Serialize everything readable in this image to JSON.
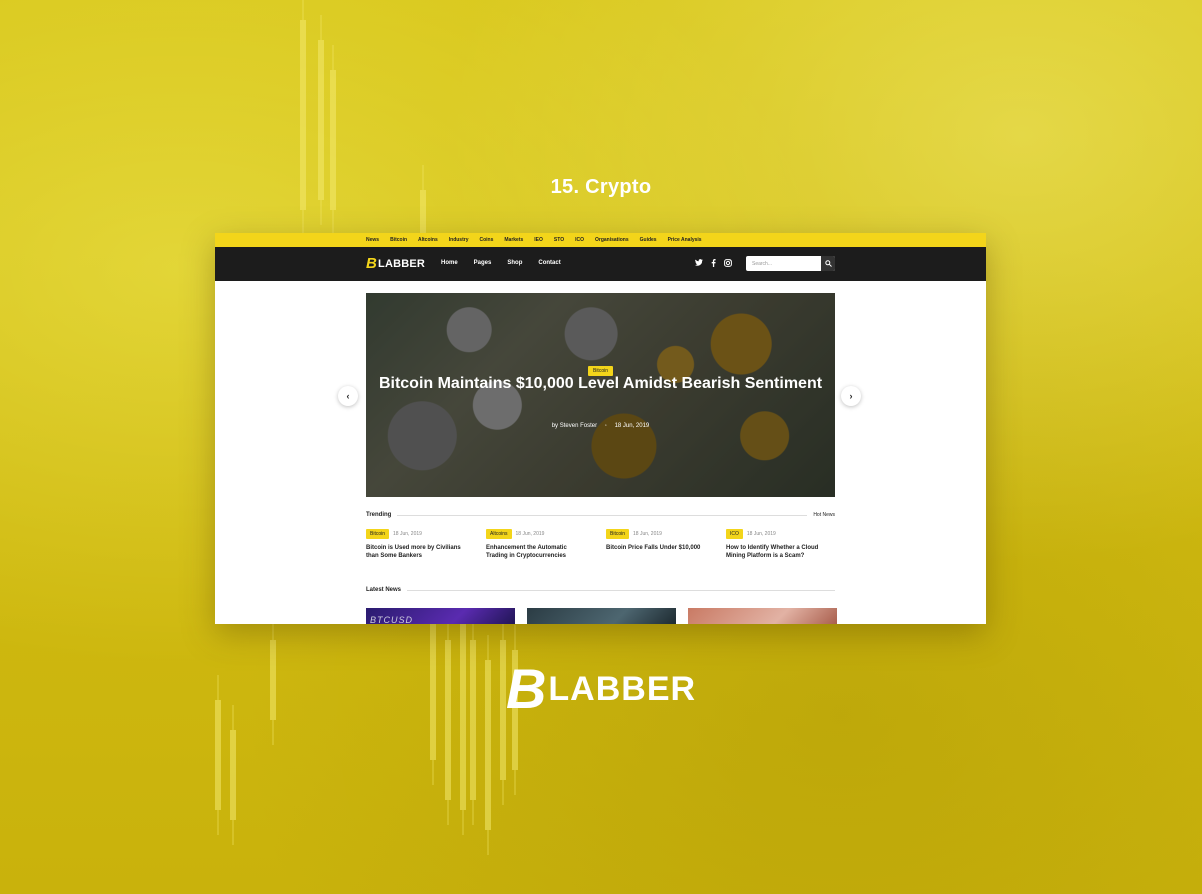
{
  "colors": {
    "accent": "#f3d51a",
    "nav_bg": "#1c1c1c",
    "background": "#d6c216"
  },
  "preview_title": "15. Crypto",
  "topbar": {
    "items": [
      "News",
      "Bitcoin",
      "Altcoins",
      "Industry",
      "Coins",
      "Markets",
      "IEO",
      "STO",
      "ICO",
      "Organisations",
      "Guides",
      "Price Analysis"
    ]
  },
  "navbar": {
    "logo_mark": "B",
    "logo_text": "LABBER",
    "links": [
      "Home",
      "Pages",
      "Shop",
      "Contact"
    ],
    "social_icons": [
      "twitter-icon",
      "facebook-icon",
      "instagram-icon"
    ],
    "search_placeholder": "Search...",
    "search_icon": "search-icon"
  },
  "hero": {
    "tag": "Bitcoin",
    "title": "Bitcoin Maintains $10,000 Level Amidst Bearish Sentiment",
    "author": "by Steven Foster",
    "date": "18 Jun, 2019",
    "prev_icon": "chevron-left-icon",
    "next_icon": "chevron-right-icon"
  },
  "trending": {
    "label": "Trending",
    "more": "Hot News",
    "items": [
      {
        "tag": "Bitcoin",
        "date": "18 Jun, 2019",
        "title": "Bitcoin is Used more by Civilians than Some Bankers"
      },
      {
        "tag": "Altcoins",
        "date": "18 Jun, 2019",
        "title": "Enhancement the Automatic Trading in Cryptocurrencies"
      },
      {
        "tag": "Bitcoin",
        "date": "18 Jun, 2019",
        "title": "Bitcoin Price Falls Under $10,000"
      },
      {
        "tag": "ICO",
        "date": "18 Jun, 2019",
        "title": "How to Identify Whether a Cloud Mining Platform is a Scam?"
      }
    ]
  },
  "latest_news": {
    "label": "Latest News",
    "card_text": "BTCUSD"
  },
  "brand": {
    "mark": "B",
    "text": "LABBER"
  }
}
